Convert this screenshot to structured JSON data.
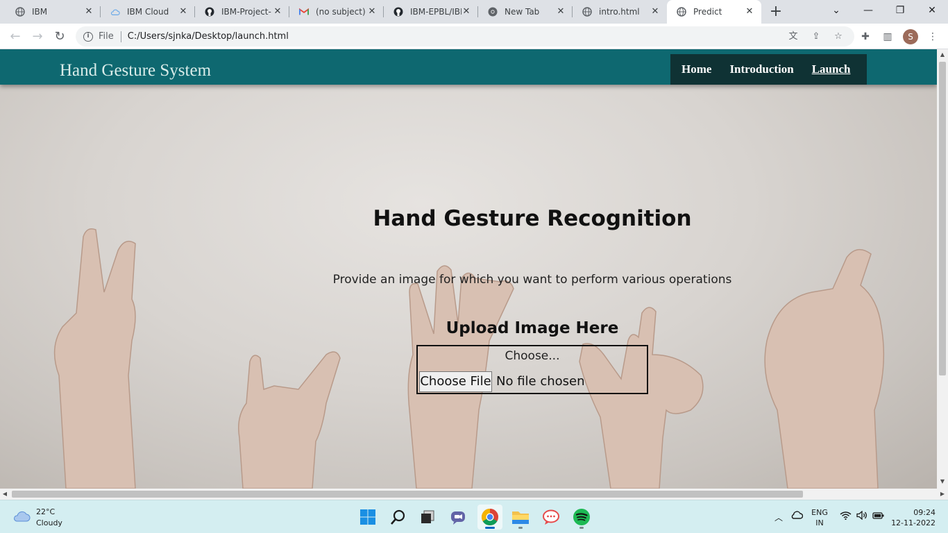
{
  "browser": {
    "tabs": [
      {
        "label": "IBM",
        "icon": "globe-icon"
      },
      {
        "label": "IBM Cloud",
        "icon": "cloud-icon"
      },
      {
        "label": "IBM-Project-",
        "icon": "github-icon"
      },
      {
        "label": "(no subject) -",
        "icon": "gmail-icon"
      },
      {
        "label": "IBM-EPBL/IBM",
        "icon": "github-icon"
      },
      {
        "label": "New Tab",
        "icon": "chrome-icon"
      },
      {
        "label": "intro.html",
        "icon": "globe-icon"
      },
      {
        "label": "Predict",
        "icon": "globe-icon"
      }
    ],
    "active_tab": "Predict",
    "address": {
      "scheme": "File",
      "url": "C:/Users/sjnka/Desktop/launch.html"
    },
    "profile_initial": "S"
  },
  "site": {
    "title": "Hand Gesture System",
    "nav": {
      "home": "Home",
      "introduction": "Introduction",
      "launch": "Launch"
    }
  },
  "main": {
    "heading": "Hand Gesture Recognition",
    "subtitle": "Provide an image for which you want to perform various operations",
    "upload_label": "Upload Image Here",
    "choose_label": "Choose...",
    "file_button": "Choose File",
    "file_status": "No file chosen"
  },
  "taskbar": {
    "weather": {
      "temp": "22°C",
      "desc": "Cloudy"
    },
    "language": {
      "line1": "ENG",
      "line2": "IN"
    },
    "clock": {
      "time": "09:24",
      "date": "12-11-2022"
    }
  },
  "colors": {
    "header_bg": "#0e6870",
    "nav_bg": "#0f3234",
    "title_text": "#d9ece9"
  }
}
